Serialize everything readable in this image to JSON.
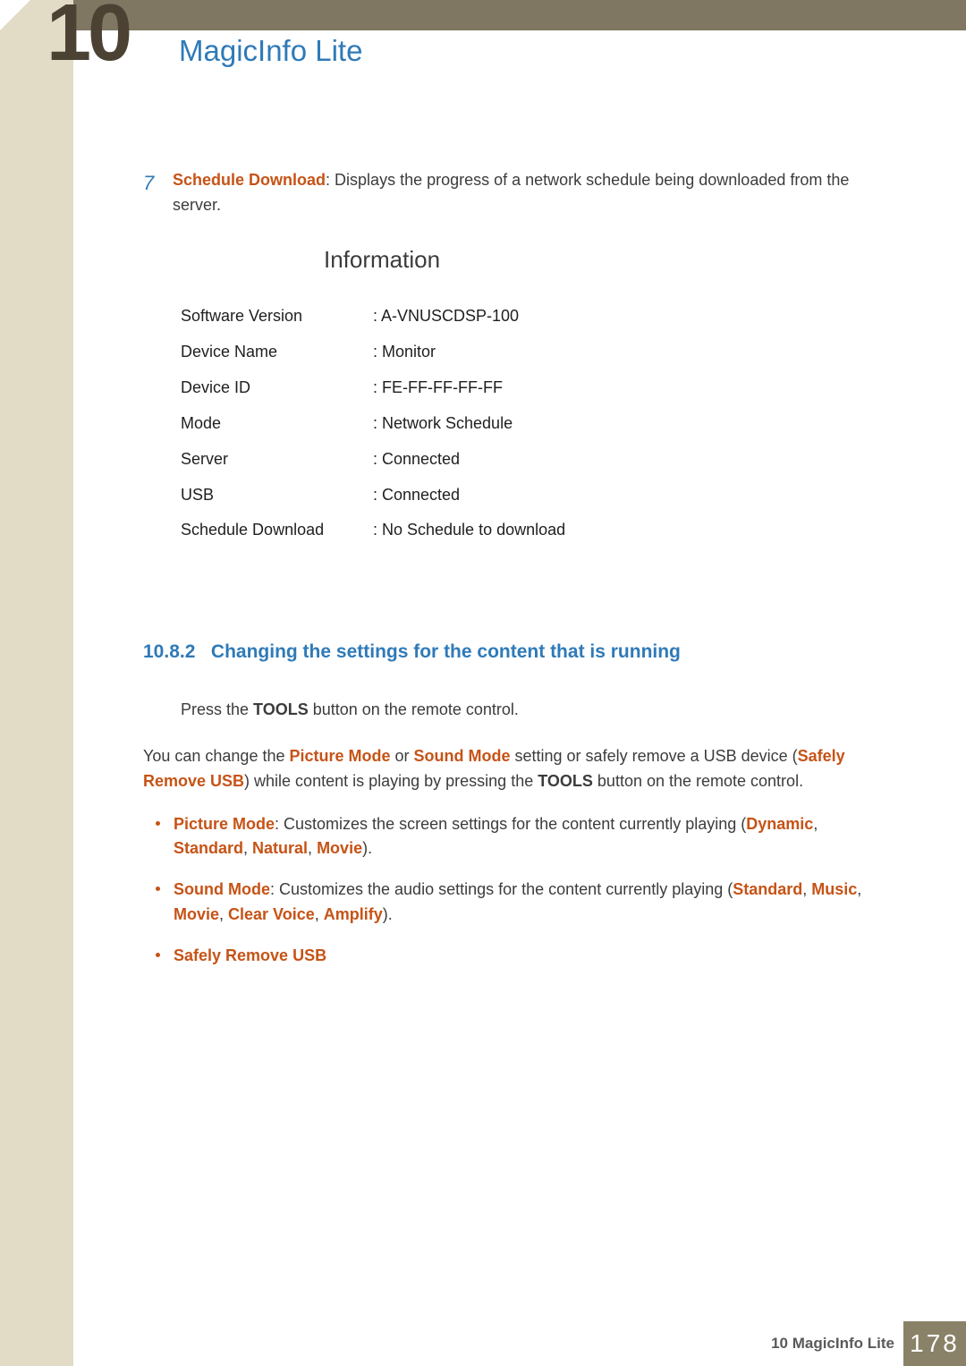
{
  "chapter": {
    "num": "10",
    "title": "MagicInfo Lite"
  },
  "step": {
    "num": "7",
    "term": "Schedule Download",
    "desc": ": Displays the progress of a network schedule being downloaded from the server."
  },
  "info": {
    "title": "Information",
    "rows": [
      {
        "label": "Software Version",
        "value": ": A-VNUSCDSP-100"
      },
      {
        "label": "Device Name",
        "value": ": Monitor"
      },
      {
        "label": "Device ID",
        "value": ": FE-FF-FF-FF-FF"
      },
      {
        "label": "Mode",
        "value": ": Network Schedule"
      },
      {
        "label": "Server",
        "value": ": Connected"
      },
      {
        "label": "USB",
        "value": ": Connected"
      },
      {
        "label": "Schedule Download",
        "value": ": No Schedule to download"
      }
    ]
  },
  "subsection": {
    "num": "10.8.2",
    "title": "Changing the settings for the content that is running",
    "substep_pre": "Press the ",
    "substep_b": "TOOLS",
    "substep_post": " button on the remote control.",
    "para": {
      "p1": "You can change the ",
      "h1": "Picture Mode",
      "p2": " or ",
      "h2": "Sound Mode",
      "p3": " setting or safely remove a USB device (",
      "h3": "Safely Remove USB",
      "p4": ") while content is playing by pressing the ",
      "b1": "TOOLS",
      "p5": " button on the remote control."
    },
    "bullets": {
      "b1": {
        "h1": "Picture Mode",
        "t1": ": Customizes the screen settings for the content currently playing (",
        "h2": "Dynamic",
        "c1": ", ",
        "h3": "Standard",
        "c2": ", ",
        "h4": "Natural",
        "c3": ", ",
        "h5": "Movie",
        "t2": ")."
      },
      "b2": {
        "h1": "Sound Mode",
        "t1": ": Customizes the audio settings for the content currently playing (",
        "h2": "Standard",
        "c1": ", ",
        "h3": "Music",
        "c2": ", ",
        "h4": "Movie",
        "c3": ", ",
        "h5": "Clear Voice",
        "c4": ", ",
        "h6": "Amplify",
        "t2": ")."
      },
      "b3": {
        "h1": "Safely Remove USB"
      }
    }
  },
  "footer": {
    "label": "10 MagicInfo Lite",
    "page": "178"
  }
}
